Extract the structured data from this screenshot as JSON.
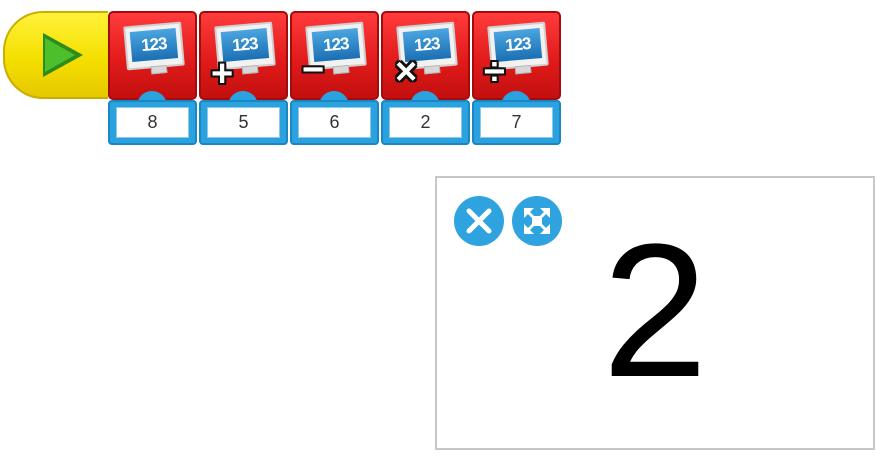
{
  "program": {
    "blocks": [
      {
        "screen_text": "123",
        "operator": "",
        "value": "8"
      },
      {
        "screen_text": "123",
        "operator": "+",
        "value": "5"
      },
      {
        "screen_text": "123",
        "operator": "−",
        "value": "6"
      },
      {
        "screen_text": "123",
        "operator": "×",
        "value": "2"
      },
      {
        "screen_text": "123",
        "operator": "÷",
        "value": "7"
      }
    ]
  },
  "display": {
    "value": "2"
  },
  "icons": {
    "start": "play-icon",
    "close": "close-icon",
    "expand": "expand-icon"
  },
  "colors": {
    "start_block": "#f4df00",
    "math_block": "#e21b1b",
    "input_tab": "#2aa2e0",
    "panel_button": "#2ea3e0"
  }
}
